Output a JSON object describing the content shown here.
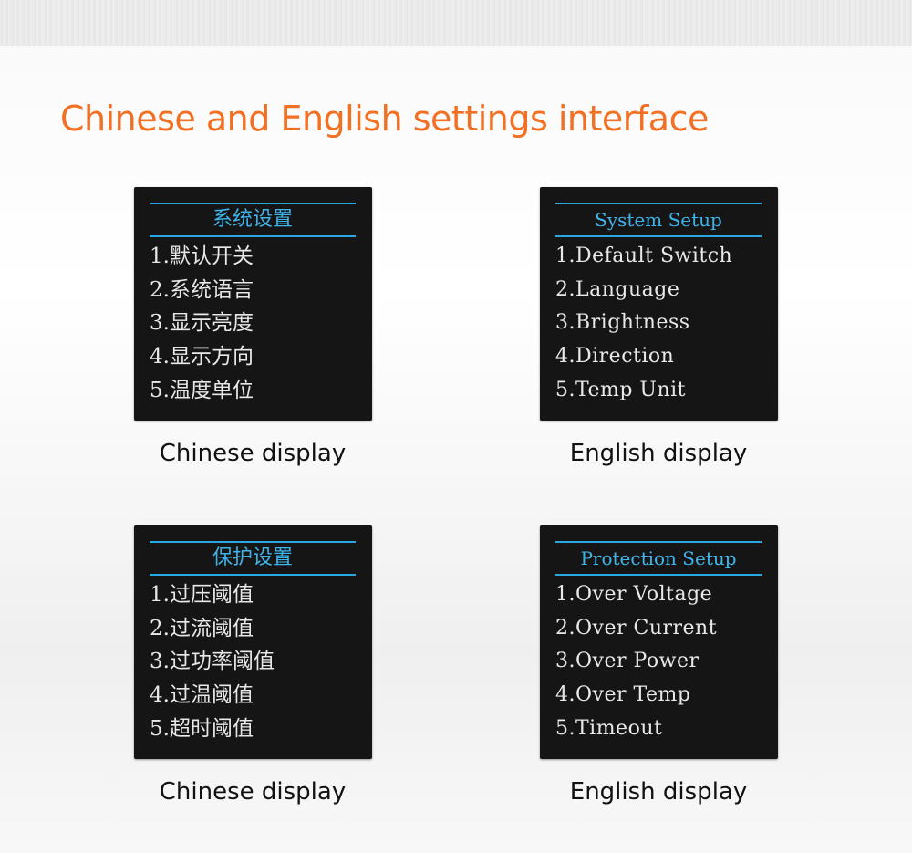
{
  "title": "Chinese and English settings interface",
  "panels": [
    {
      "header": "系统设置",
      "items": [
        "1.默认开关",
        "2.系统语言",
        "3.显示亮度",
        "4.显示方向",
        "5.温度单位"
      ],
      "caption": "Chinese display"
    },
    {
      "header": "System Setup",
      "items": [
        "1.Default Switch",
        "2.Language",
        "3.Brightness",
        "4.Direction",
        "5.Temp Unit"
      ],
      "caption": "English display"
    },
    {
      "header": "保护设置",
      "items": [
        "1.过压阈值",
        "2.过流阈值",
        "3.过功率阈值",
        "4.过温阈值",
        "5.超时阈值"
      ],
      "caption": "Chinese display"
    },
    {
      "header": "Protection Setup",
      "items": [
        "1.Over Voltage",
        "2.Over Current",
        "3.Over Power",
        "4.Over Temp",
        "5.Timeout"
      ],
      "caption": "English display"
    }
  ],
  "colors": {
    "title": "#f27023",
    "header_text": "#3fb4ea",
    "header_rule": "#2aa7e0",
    "screen_bg": "#151515",
    "item_text": "#e8e8e8"
  }
}
